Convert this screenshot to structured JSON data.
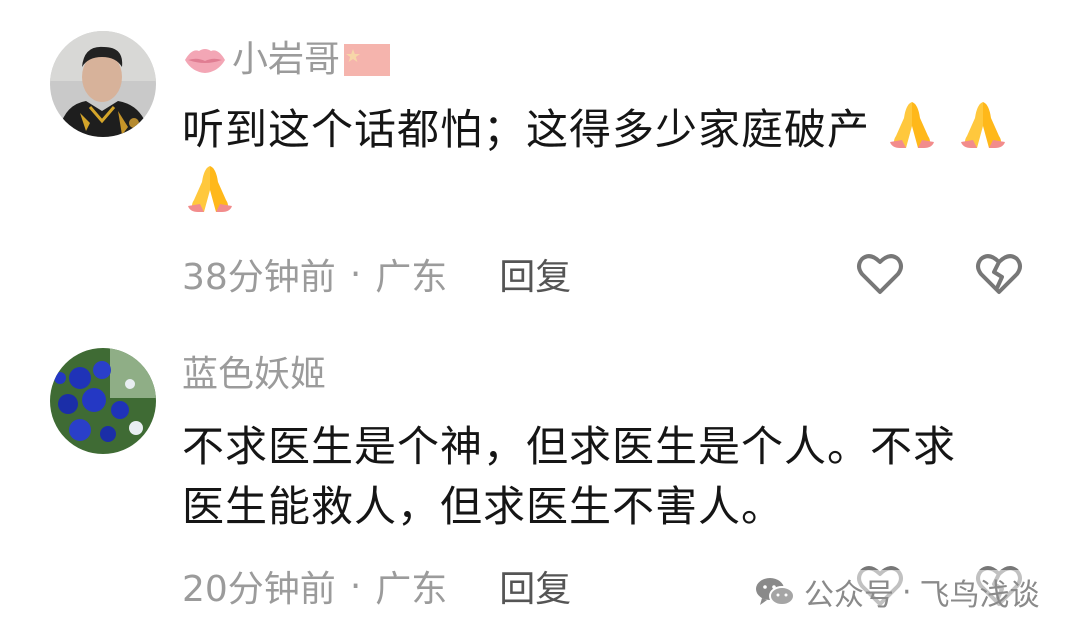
{
  "comments": [
    {
      "username": "小岩哥",
      "username_color": "#9b9b9b",
      "text": "听到这个话都怕；这得多少家庭破产",
      "trailing_emoji": [
        "folded-hands",
        "folded-hands",
        "folded-hands"
      ],
      "time": "38分钟前",
      "separator": "·",
      "location": "广东",
      "reply_label": "回复",
      "avatar_icon": "user-photo-avatar",
      "badges": [
        "lips-icon",
        "flag-icon"
      ]
    },
    {
      "username": "蓝色妖姬",
      "username_color": "#9b9b9b",
      "text_line1": "不求医生是个神，但求医生是个人。不求",
      "text_line2": "医生能救人，但求医生不害人。",
      "time": "20分钟前",
      "separator": "·",
      "location": "广东",
      "reply_label": "回复",
      "avatar_icon": "blue-roses-avatar"
    }
  ],
  "watermark": {
    "label": "公众号",
    "separator": "·",
    "account": "飞鸟浅谈",
    "icon": "wechat-icon"
  },
  "colors": {
    "meta_gray": "#9b9b9b",
    "reply_gray": "#555555",
    "text": "#151515",
    "heart_outline": "#777777"
  }
}
